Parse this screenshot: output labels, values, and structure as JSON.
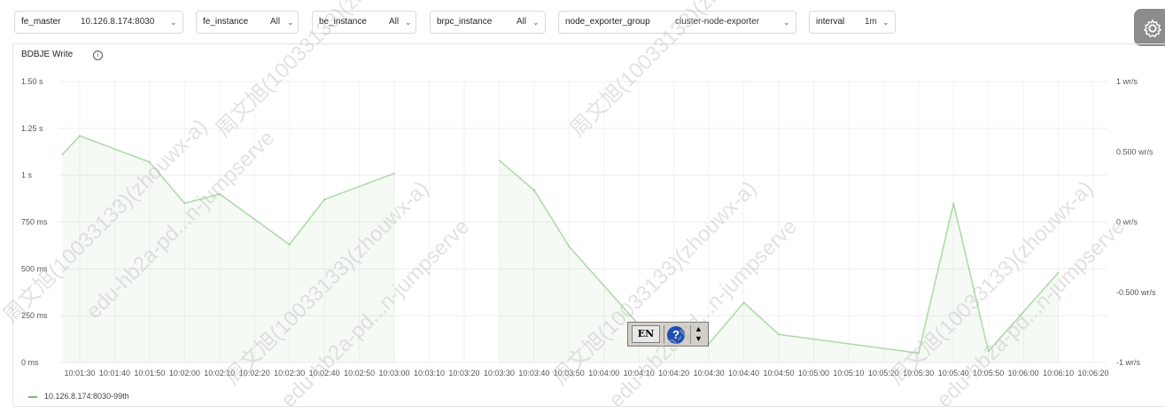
{
  "filters": [
    {
      "label": "fe_master",
      "value": "10.126.8.174:8030"
    },
    {
      "label": "fe_instance",
      "value": "All"
    },
    {
      "label": "be_instance",
      "value": "All"
    },
    {
      "label": "brpc_instance",
      "value": "All"
    },
    {
      "label": "node_exporter_group",
      "value": "cluster-node-exporter"
    },
    {
      "label": "interval",
      "value": "1m"
    }
  ],
  "panel": {
    "title": "BDBJE Write",
    "info_symbol": "i"
  },
  "legend": {
    "series_name": "10.126.8.174:8030-99th"
  },
  "ime": {
    "language": "EN",
    "help_symbol": "?"
  },
  "watermark": {
    "lines": [
      "周文旭(10033133)(zhouwx-a)",
      "edu-hb2a-pd...n-jumpserve"
    ]
  },
  "chart_data": {
    "type": "area",
    "y_ticks_left": [
      "0 ms",
      "250 ms",
      "500 ms",
      "750 ms",
      "1 s",
      "1.25 s",
      "1.50 s"
    ],
    "y_ticks_right": [
      "-1 wr/s",
      "-0.500 wr/s",
      "0 wr/s",
      "0.500 wr/s",
      "1 wr/s"
    ],
    "ylim_seconds": [
      0,
      1.5
    ],
    "x_ticks": [
      "10:01:30",
      "10:01:40",
      "10:01:50",
      "10:02:00",
      "10:02:10",
      "10:02:20",
      "10:02:30",
      "10:02:40",
      "10:02:50",
      "10:03:00",
      "10:03:10",
      "10:03:20",
      "10:03:30",
      "10:03:40",
      "10:03:50",
      "10:04:00",
      "10:04:10",
      "10:04:20",
      "10:04:30",
      "10:04:40",
      "10:04:50",
      "10:05:00",
      "10:05:10",
      "10:05:20",
      "10:05:30",
      "10:05:40",
      "10:05:50",
      "10:06:00",
      "10:06:10",
      "10:06:20"
    ],
    "grid": true,
    "legend_position": "bottom-left",
    "color": "#73bf69",
    "series": [
      {
        "name": "10.126.8.174:8030-99th",
        "segments": [
          [
            [
              "10:01:25",
              1.11
            ],
            [
              "10:01:30",
              1.21
            ],
            [
              "10:01:50",
              1.07
            ],
            [
              "10:02:00",
              0.85
            ],
            [
              "10:02:10",
              0.9
            ],
            [
              "10:02:30",
              0.63
            ],
            [
              "10:02:40",
              0.87
            ],
            [
              "10:03:00",
              1.01
            ]
          ],
          [
            [
              "10:03:30",
              1.08
            ],
            [
              "10:03:40",
              0.92
            ],
            [
              "10:03:50",
              0.62
            ],
            [
              "10:04:10",
              0.2
            ],
            [
              "10:04:30",
              0.1
            ],
            [
              "10:04:40",
              0.32
            ],
            [
              "10:04:50",
              0.15
            ],
            [
              "10:05:30",
              0.05
            ],
            [
              "10:05:40",
              0.85
            ],
            [
              "10:05:50",
              0.06
            ],
            [
              "10:06:10",
              0.48
            ]
          ]
        ]
      }
    ]
  }
}
